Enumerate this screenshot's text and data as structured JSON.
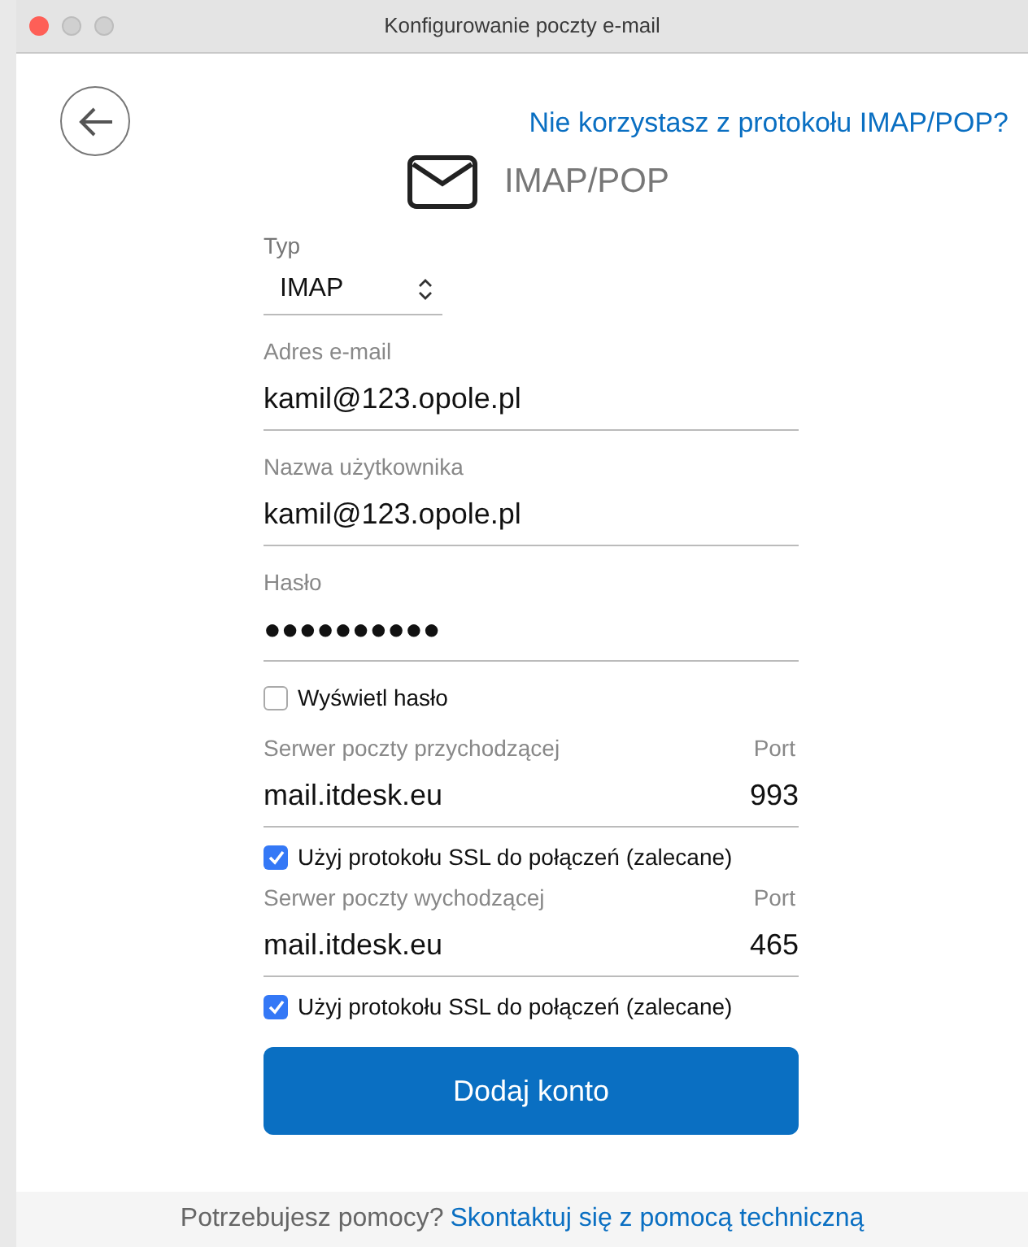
{
  "window": {
    "title": "Konfigurowanie poczty e-mail"
  },
  "alt_link": "Nie korzystasz z protokołu IMAP/POP?",
  "heading": "IMAP/POP",
  "type": {
    "label": "Typ",
    "value": "IMAP"
  },
  "fields": [
    {
      "label": "Adres e-mail",
      "value": "kamil@123.opole.pl"
    },
    {
      "label": "Nazwa użytkownika",
      "value": "kamil@123.opole.pl"
    },
    {
      "label": "Hasło",
      "value": "●●●●●●●●●●"
    }
  ],
  "show_password": {
    "label": "Wyświetl hasło",
    "checked": false
  },
  "servers": [
    {
      "label": "Serwer poczty przychodzącej",
      "port_label": "Port",
      "value": "mail.itdesk.eu",
      "port": "993",
      "ssl": {
        "label": "Użyj protokołu SSL do połączeń (zalecane)",
        "checked": true
      }
    },
    {
      "label": "Serwer poczty wychodzącej",
      "port_label": "Port",
      "value": "mail.itdesk.eu",
      "port": "465",
      "ssl": {
        "label": "Użyj protokołu SSL do połączeń (zalecane)",
        "checked": true
      }
    }
  ],
  "submit": "Dodaj konto",
  "footer": {
    "text": "Potrzebujesz pomocy?",
    "link": "Skontaktuj się z pomocą techniczną"
  }
}
